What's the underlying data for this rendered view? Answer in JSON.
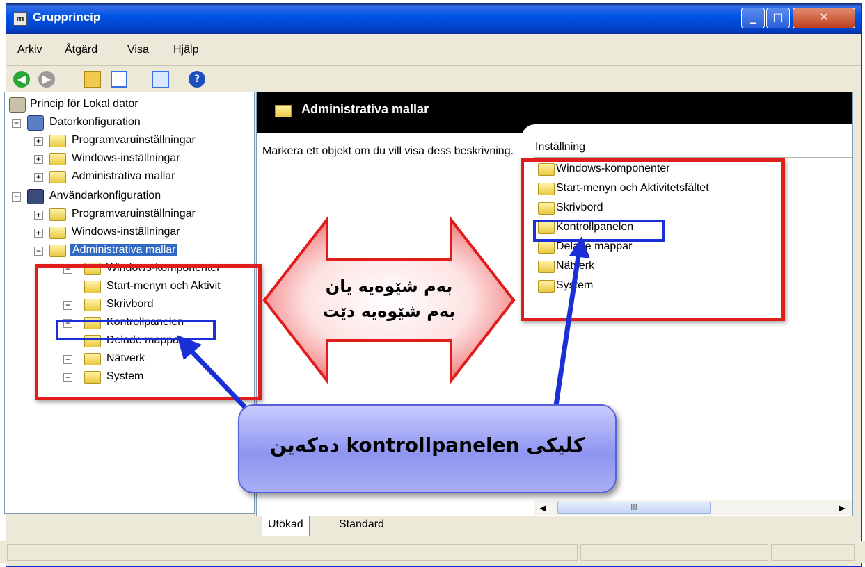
{
  "window": {
    "title": "Grupprincip",
    "app_icon": "mmc-icon"
  },
  "menu": {
    "arkiv": "Arkiv",
    "atgard": "Åtgärd",
    "visa": "Visa",
    "hjalp": "Hjälp"
  },
  "toolbar": {
    "back": "back-icon",
    "forward": "forward-icon",
    "up": "up-folder-icon",
    "tree": "show-tree-icon",
    "export": "export-list-icon",
    "help": "help-icon",
    "help_glyph": "?"
  },
  "tree": {
    "root": "Princip för Lokal dator",
    "computer_config": "Datorkonfiguration",
    "cc_software": "Programvaruinställningar",
    "cc_windows": "Windows-inställningar",
    "cc_admin": "Administrativa mallar",
    "user_config": "Användarkonfiguration",
    "uc_software": "Programvaruinställningar",
    "uc_windows": "Windows-inställningar",
    "uc_admin": "Administrativa mallar",
    "uc_components": "Windows-komponenter",
    "uc_startmenu": "Start-menyn och Aktivit",
    "uc_desktop": "Skrivbord",
    "uc_controlpanel": "Kontrollpanelen",
    "uc_shared": "Delade mappar",
    "uc_network": "Nätverk",
    "uc_system": "System"
  },
  "right": {
    "header": "Administrativa mallar",
    "description": "Markera ett objekt om du vill visa dess beskrivning.",
    "column": "Inställning",
    "items": [
      "Windows-komponenter",
      "Start-menyn och Aktivitetsfältet",
      "Skrivbord",
      "Kontrollpanelen",
      "Delade mappar",
      "Nätverk",
      "System"
    ]
  },
  "scroll": {
    "thumb_glyph": "III"
  },
  "tabs": {
    "extended": "Utökad",
    "standard": "Standard"
  },
  "annotation": {
    "arrow_line1": "بەم شێوەیە یان",
    "arrow_line2": "بەم شێوەیە دێت",
    "callout": "کلیکی kontrollpanelen دەکەین"
  },
  "colors": {
    "highlight_red": "#e01c1c",
    "highlight_blue": "#1a2fd6",
    "selection": "#316ac5"
  }
}
